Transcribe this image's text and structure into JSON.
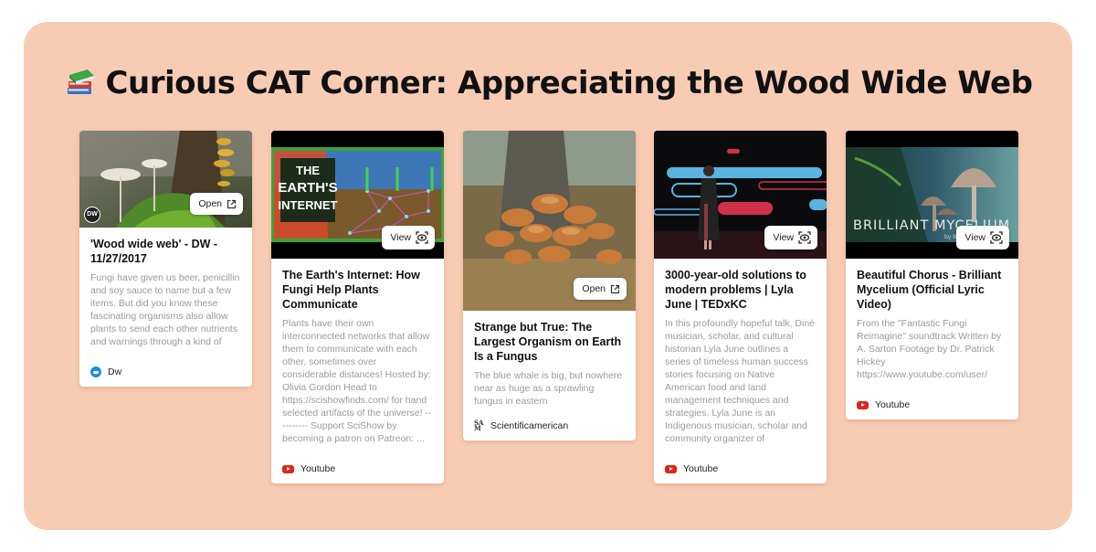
{
  "page": {
    "title": "Curious CAT Corner: Appreciating the Wood Wide Web",
    "title_icon": "books-emoji",
    "background_color": "#f8ccb4"
  },
  "cards": [
    {
      "title": "'Wood wide web' - DW - 11/27/2017",
      "description": "Fungi have given us beer, penicillin and soy sauce to name but a few items. But did you know these fascinating organisms also allow plants to send each other nutrients and warnings through a kind of",
      "source": "Dw",
      "source_icon": "dw-logo-icon",
      "action_label": "Open",
      "action_icon": "external-link-icon",
      "thumbnail": "mushrooms on mossy tree trunk"
    },
    {
      "title": "The Earth's Internet: How Fungi Help Plants Communicate",
      "description": "Plants have their own interconnected networks that allow them to communicate with each other, sometimes over considerable distances! Hosted by: Olivia Gordon Head to https://scishowfinds.com/ for hand selected artifacts of the universe! ---------- Support SciShow by becoming a patron on Patreon: ...",
      "source": "Youtube",
      "source_icon": "youtube-icon",
      "action_label": "View",
      "action_icon": "eye-scan-icon",
      "thumbnail_text": [
        "THE",
        "EARTH'S",
        "INTERNET"
      ]
    },
    {
      "title": "Strange but True: The Largest Organism on Earth Is a Fungus",
      "description": "The blue whale is big, but nowhere near as huge as a sprawling fungus in eastern",
      "source": "Scientificamerican",
      "source_icon": "scientific-american-icon",
      "action_label": "Open",
      "action_icon": "external-link-icon",
      "thumbnail": "cluster of honey fungus mushrooms"
    },
    {
      "title": "3000-year-old solutions to modern problems | Lyla June | TEDxKC",
      "description": "In this profoundly hopeful talk, Diné musician, scholar, and cultural historian Lyla June outlines a series of timeless human success stories focusing on Native American food and land management techniques and strategies. Lyla June is an Indigenous musician, scholar and community organizer of",
      "source": "Youtube",
      "source_icon": "youtube-icon",
      "action_label": "View",
      "action_icon": "eye-scan-icon",
      "thumbnail": "speaker on TEDx stage"
    },
    {
      "title": "Beautiful Chorus - Brilliant Mycelium (Official Lyric Video)",
      "description": "From the \"Fantastic Fungi Reimagine\" soundtrack Written by A. Sarton Footage by Dr. Patrick Hickey https://www.youtube.com/user/",
      "source": "Youtube",
      "source_icon": "youtube-icon",
      "action_label": "View",
      "action_icon": "eye-scan-icon",
      "thumbnail_text": [
        "BRILLIANT MYCELIUM",
        "by Be"
      ]
    }
  ]
}
